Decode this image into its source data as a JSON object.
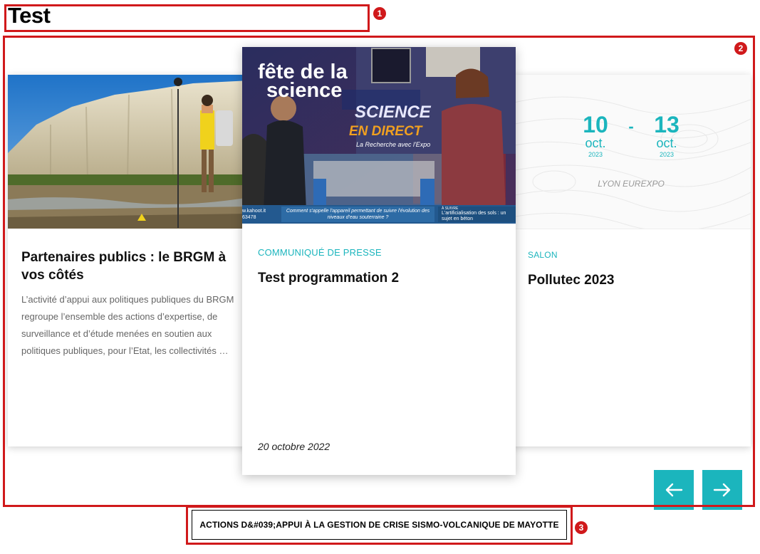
{
  "page": {
    "title": "Test"
  },
  "cards": [
    {
      "title": "Partenaires publics : le BRGM à vos côtés",
      "excerpt": "L’activité d’appui aux politiques publiques du BRGM regroupe l’ensemble des actions d’expertise, de surveillance et d’étude menées en soutien aux politiques publiques, pour l’Etat, les collectivités …"
    },
    {
      "category": "Communiqué de presse",
      "title": "Test programmation 2",
      "date": "20 octobre 2022",
      "image_text": {
        "fete": "fête de la",
        "science": "science",
        "science_big": "SCIENCE",
        "en_direct": "EN DIRECT",
        "recherche": "La Recherche avec l'Expo",
        "ticker_left": "w.kahoot.it\n63478",
        "ticker_mid": "Comment s'appelle l'appareil permettant de suivre l'évolution des niveaux d'eau souterraine ?",
        "ticker_right_small": "À SUIVRE",
        "ticker_right": "L'artificialisation des sols : un sujet en béton"
      }
    },
    {
      "category": "Salon",
      "title": "Pollutec 2023",
      "date_start": {
        "day": "10",
        "month": "oct.",
        "year": "2023"
      },
      "date_sep": "-",
      "date_end": {
        "day": "13",
        "month": "oct.",
        "year": "2023"
      },
      "location": "LYON EUREXPO"
    }
  ],
  "nav": {
    "prev_icon": "arrow-left-icon",
    "next_icon": "arrow-right-icon"
  },
  "bottom_link": {
    "label": "ACTIONS D&#039;APPUI À LA GESTION DE CRISE SISMO-VOLCANIQUE DE MAYOTTE"
  },
  "annotations": [
    "1",
    "2",
    "3"
  ],
  "colors": {
    "accent": "#1bb5bd",
    "annotation": "#d0191b"
  }
}
